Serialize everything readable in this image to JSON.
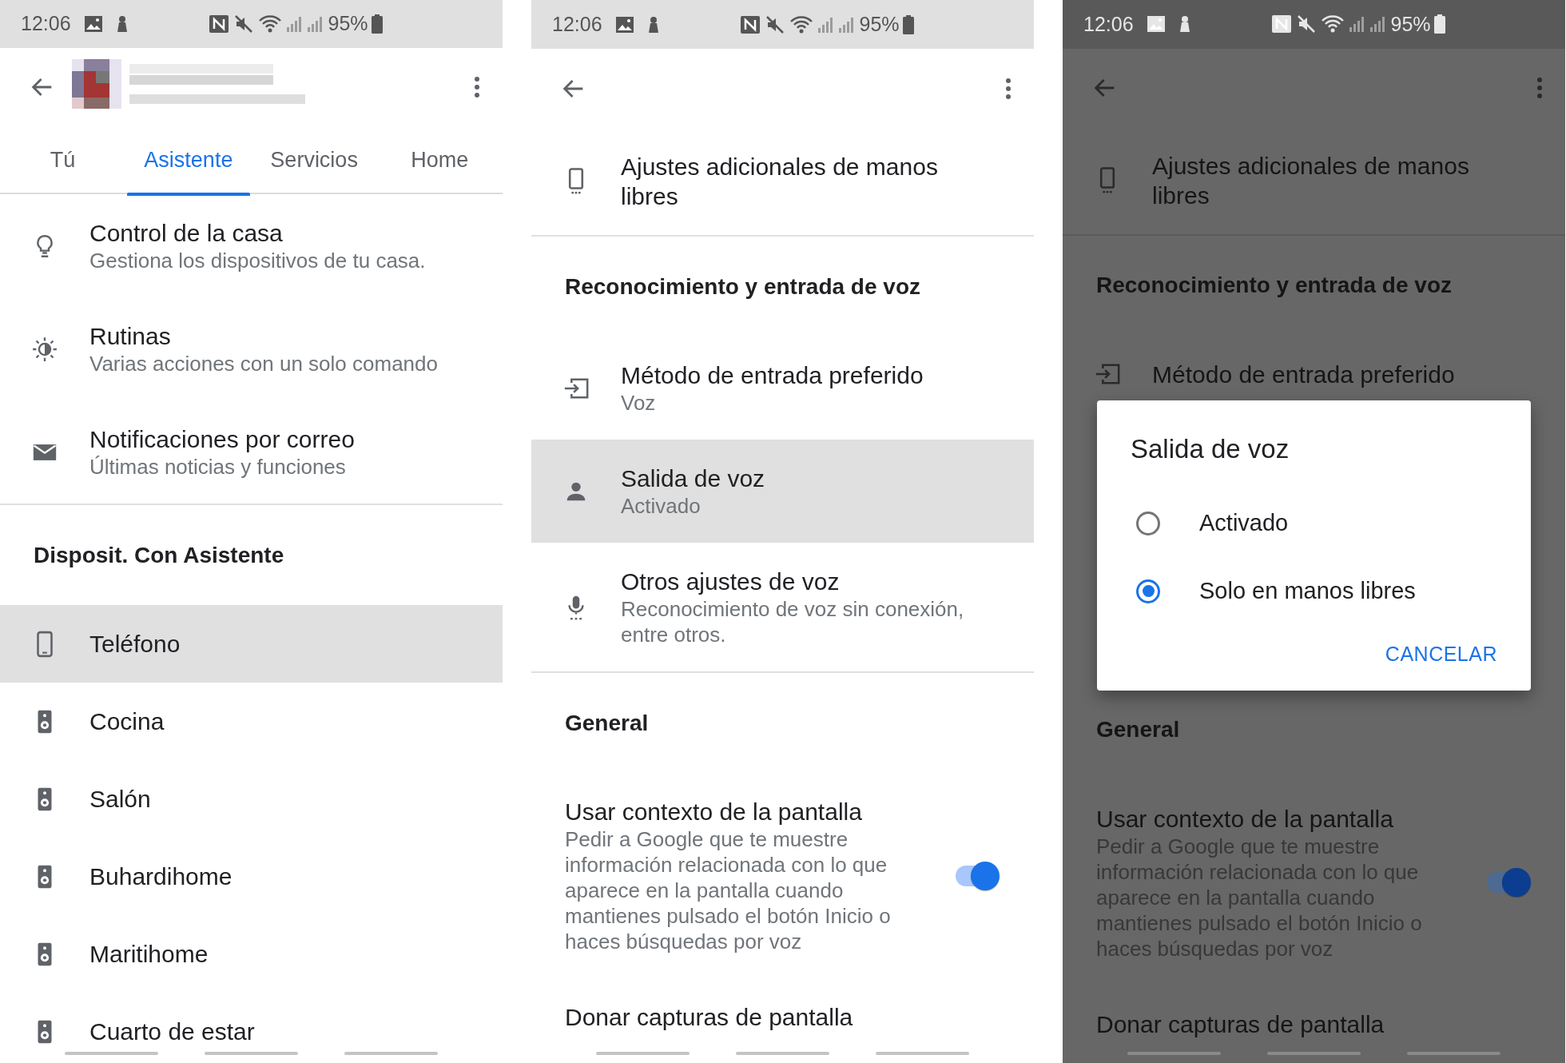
{
  "screens": [
    {
      "dimmed": false,
      "status_bar": {
        "time": "12:06",
        "battery": "95%"
      },
      "header": {
        "kind": "picture"
      },
      "tabs": [
        {
          "label": "Tú",
          "selected": false
        },
        {
          "label": "Asistente",
          "selected": true
        },
        {
          "label": "Servicios",
          "selected": false
        },
        {
          "label": "Home",
          "selected": false
        }
      ],
      "sections": [
        {
          "kind": "list",
          "items": [
            {
              "kind": "home-control",
              "title": "Control de la casa",
              "subtitle": "Gestiona los dispositivos de tu casa.",
              "selected": false
            },
            {
              "kind": "routines",
              "title": "Rutinas",
              "subtitle": "Varias acciones con un solo comando",
              "selected": false
            },
            {
              "kind": "email",
              "title": "Notificaciones por correo",
              "subtitle": "Últimas noticias y funciones",
              "selected": false
            }
          ]
        },
        {
          "kind": "list",
          "title": "Disposit. Con Asistente",
          "items": [
            {
              "kind": "phone",
              "title": "Teléfono",
              "selected": true
            },
            {
              "kind": "speaker",
              "title": "Cocina",
              "selected": false
            },
            {
              "kind": "speaker",
              "title": "Salón",
              "selected": false
            },
            {
              "kind": "speaker",
              "title": "Buhardihome",
              "selected": false
            },
            {
              "kind": "speaker",
              "title": "Maritihome",
              "selected": false
            },
            {
              "kind": "speaker",
              "title": "Cuarto de estar",
              "selected": false
            }
          ]
        }
      ]
    },
    {
      "dimmed": false,
      "status_bar": {
        "time": "12:06",
        "battery": "95%"
      },
      "sections": [
        {
          "kind": "list",
          "items": [
            {
              "kind": "handsfree",
              "title": "Ajustes adicionales de manos libres",
              "selected": false
            }
          ]
        },
        {
          "kind": "list",
          "title": "Reconocimiento y entrada de voz",
          "items": [
            {
              "kind": "input-method",
              "title": "Método de entrada preferido",
              "subtitle": "Voz",
              "selected": false
            },
            {
              "kind": "voice-output",
              "title": "Salida de voz",
              "subtitle": "Activado",
              "selected": true
            },
            {
              "kind": "voice-settings",
              "title": "Otros ajustes de voz",
              "subtitle": "Reconocimiento de voz sin conexión, entre otros.",
              "selected": false
            }
          ]
        },
        {
          "kind": "list",
          "title": "General",
          "items": [
            {
              "kind": "toggle",
              "title": "Usar contexto de la pantalla",
              "subtitle": "Pedir a Google que te muestre información relacionada con lo que aparece en la pantalla cuando mantienes pulsado el botón Inicio o haces búsquedas por voz",
              "on": true,
              "selected": false
            },
            {
              "kind": "plain",
              "title": "Donar capturas de pantalla",
              "selected": false
            }
          ]
        }
      ]
    },
    {
      "dimmed": true,
      "status_bar": {
        "time": "12:06",
        "battery": "95%"
      },
      "sections": [
        {
          "kind": "list",
          "items": [
            {
              "kind": "handsfree",
              "title": "Ajustes adicionales de manos libres",
              "selected": false
            }
          ]
        },
        {
          "kind": "list",
          "title": "Reconocimiento y entrada de voz",
          "items": [
            {
              "kind": "input-method",
              "title": "Método de entrada preferido",
              "selected": false
            }
          ]
        },
        {
          "kind": "dialog",
          "title": "Salida de voz",
          "options": [
            {
              "label": "Activado",
              "selected": false
            },
            {
              "label": "Solo en manos libres",
              "selected": true
            }
          ],
          "button": "CANCELAR"
        },
        {
          "kind": "list",
          "title": "General",
          "items": [
            {
              "kind": "toggle",
              "title": "Usar contexto de la pantalla",
              "subtitle": "Pedir a Google que te muestre información relacionada con lo que aparece en la pantalla cuando mantienes pulsado el botón Inicio o haces búsquedas por voz",
              "on": true,
              "selected": false
            },
            {
              "kind": "plain",
              "title": "Donar capturas de pantalla",
              "selected": false
            }
          ]
        }
      ]
    }
  ]
}
